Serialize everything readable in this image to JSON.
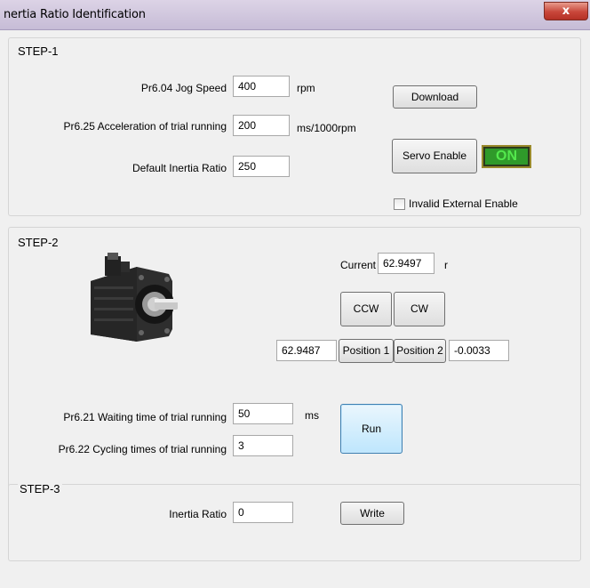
{
  "window": {
    "title": "nertia Ratio Identification",
    "close_glyph": "x"
  },
  "step1": {
    "title": "STEP-1",
    "jog_speed": {
      "label": "Pr6.04 Jog Speed",
      "value": "400",
      "unit": "rpm"
    },
    "acceleration": {
      "label": "Pr6.25 Acceleration of trial running",
      "value": "200",
      "unit": "ms/1000rpm"
    },
    "default_ratio": {
      "label": "Default Inertia Ratio",
      "value": "250"
    },
    "download_label": "Download",
    "servo_enable_label": "Servo Enable",
    "servo_status": "ON",
    "invalid_external_label": "Invalid External Enable"
  },
  "step2": {
    "title": "STEP-2",
    "current_label": "Current",
    "current_value": "62.9497",
    "current_unit": "r",
    "ccw_label": "CCW",
    "cw_label": "CW",
    "position1_value": "62.9487",
    "position1_label": "Position 1",
    "position2_label": "Position 2",
    "position2_value": "-0.0033",
    "waiting": {
      "label": "Pr6.21 Waiting time of trial running",
      "value": "50",
      "unit": "ms"
    },
    "cycling": {
      "label": "Pr6.22 Cycling times of trial running",
      "value": "3"
    },
    "run_label": "Run"
  },
  "step3": {
    "title": "STEP-3",
    "ratio": {
      "label": "Inertia Ratio",
      "value": "0"
    },
    "write_label": "Write"
  },
  "colors": {
    "titlebar": "#c9bfd9",
    "close": "#c8463a",
    "status_bg": "#2f9a2a",
    "status_text": "#53e84d",
    "run_highlight": "#bee6fd"
  },
  "icons": {
    "close": "close-icon",
    "checkbox": "checkbox-unchecked",
    "motor": "servo-motor-image"
  }
}
